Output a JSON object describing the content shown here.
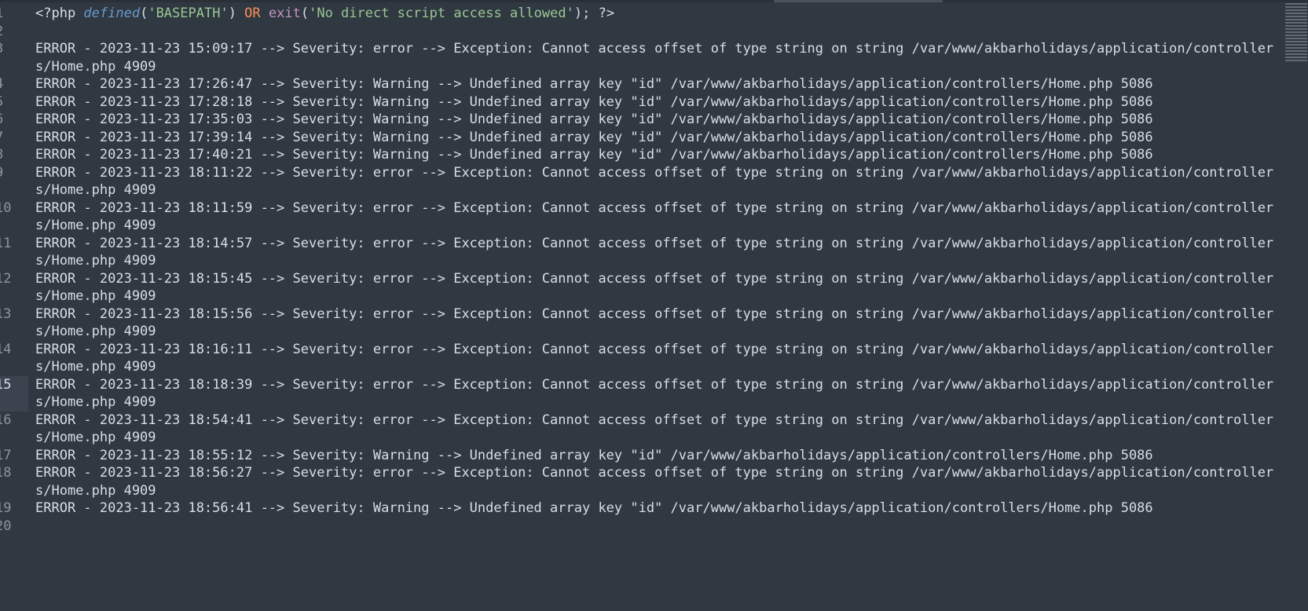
{
  "header_line": {
    "number": "1",
    "open_tag": "<?php ",
    "fn_defined": "defined",
    "paren_open": "(",
    "basepath_str": "'BASEPATH'",
    "paren_close": ") ",
    "or_kw": "OR ",
    "fn_exit": "exit",
    "exit_paren_open": "(",
    "exit_str": "'No direct script access allowed'",
    "exit_paren_close": "); ",
    "close_tag": "?>"
  },
  "lines": [
    {
      "number": "2",
      "text": "",
      "wrapped": false,
      "active": false
    },
    {
      "number": "3",
      "text": "ERROR - 2023-11-23 15:09:17 --> Severity: error --> Exception: Cannot access offset of type string on string /var/www/akbarholidays/application/controllers/Home.php 4909",
      "wrapped": true,
      "active": false
    },
    {
      "number": "4",
      "text": "ERROR - 2023-11-23 17:26:47 --> Severity: Warning --> Undefined array key \"id\" /var/www/akbarholidays/application/controllers/Home.php 5086",
      "wrapped": false,
      "active": false
    },
    {
      "number": "5",
      "text": "ERROR - 2023-11-23 17:28:18 --> Severity: Warning --> Undefined array key \"id\" /var/www/akbarholidays/application/controllers/Home.php 5086",
      "wrapped": false,
      "active": false
    },
    {
      "number": "6",
      "text": "ERROR - 2023-11-23 17:35:03 --> Severity: Warning --> Undefined array key \"id\" /var/www/akbarholidays/application/controllers/Home.php 5086",
      "wrapped": false,
      "active": false
    },
    {
      "number": "7",
      "text": "ERROR - 2023-11-23 17:39:14 --> Severity: Warning --> Undefined array key \"id\" /var/www/akbarholidays/application/controllers/Home.php 5086",
      "wrapped": false,
      "active": false
    },
    {
      "number": "8",
      "text": "ERROR - 2023-11-23 17:40:21 --> Severity: Warning --> Undefined array key \"id\" /var/www/akbarholidays/application/controllers/Home.php 5086",
      "wrapped": false,
      "active": false
    },
    {
      "number": "9",
      "text": "ERROR - 2023-11-23 18:11:22 --> Severity: error --> Exception: Cannot access offset of type string on string /var/www/akbarholidays/application/controllers/Home.php 4909",
      "wrapped": true,
      "active": false
    },
    {
      "number": "10",
      "text": "ERROR - 2023-11-23 18:11:59 --> Severity: error --> Exception: Cannot access offset of type string on string /var/www/akbarholidays/application/controllers/Home.php 4909",
      "wrapped": true,
      "active": false
    },
    {
      "number": "11",
      "text": "ERROR - 2023-11-23 18:14:57 --> Severity: error --> Exception: Cannot access offset of type string on string /var/www/akbarholidays/application/controllers/Home.php 4909",
      "wrapped": true,
      "active": false
    },
    {
      "number": "12",
      "text": "ERROR - 2023-11-23 18:15:45 --> Severity: error --> Exception: Cannot access offset of type string on string /var/www/akbarholidays/application/controllers/Home.php 4909",
      "wrapped": true,
      "active": false
    },
    {
      "number": "13",
      "text": "ERROR - 2023-11-23 18:15:56 --> Severity: error --> Exception: Cannot access offset of type string on string /var/www/akbarholidays/application/controllers/Home.php 4909",
      "wrapped": true,
      "active": false
    },
    {
      "number": "14",
      "text": "ERROR - 2023-11-23 18:16:11 --> Severity: error --> Exception: Cannot access offset of type string on string /var/www/akbarholidays/application/controllers/Home.php 4909",
      "wrapped": true,
      "active": false
    },
    {
      "number": "15",
      "text": "ERROR - 2023-11-23 18:18:39 --> Severity: error --> Exception: Cannot access offset of type string on string /var/www/akbarholidays/application/controllers/Home.php 4909",
      "wrapped": true,
      "active": true
    },
    {
      "number": "16",
      "text": "ERROR - 2023-11-23 18:54:41 --> Severity: error --> Exception: Cannot access offset of type string on string /var/www/akbarholidays/application/controllers/Home.php 4909",
      "wrapped": true,
      "active": false
    },
    {
      "number": "17",
      "text": "ERROR - 2023-11-23 18:55:12 --> Severity: Warning --> Undefined array key \"id\" /var/www/akbarholidays/application/controllers/Home.php 5086",
      "wrapped": false,
      "active": false
    },
    {
      "number": "18",
      "text": "ERROR - 2023-11-23 18:56:27 --> Severity: error --> Exception: Cannot access offset of type string on string /var/www/akbarholidays/application/controllers/Home.php 4909",
      "wrapped": true,
      "active": false
    },
    {
      "number": "19",
      "text": "ERROR - 2023-11-23 18:56:41 --> Severity: Warning --> Undefined array key \"id\" /var/www/akbarholidays/application/controllers/Home.php 5086",
      "wrapped": false,
      "active": false
    },
    {
      "number": "20",
      "text": "",
      "wrapped": false,
      "active": false
    }
  ],
  "theme": {
    "background": "#303841",
    "gutter_active": "#3b444e",
    "function_italic": "#6699cc",
    "string": "#99c794",
    "keyword": "#f99157",
    "function": "#c594c5",
    "text": "#d8dee9"
  }
}
